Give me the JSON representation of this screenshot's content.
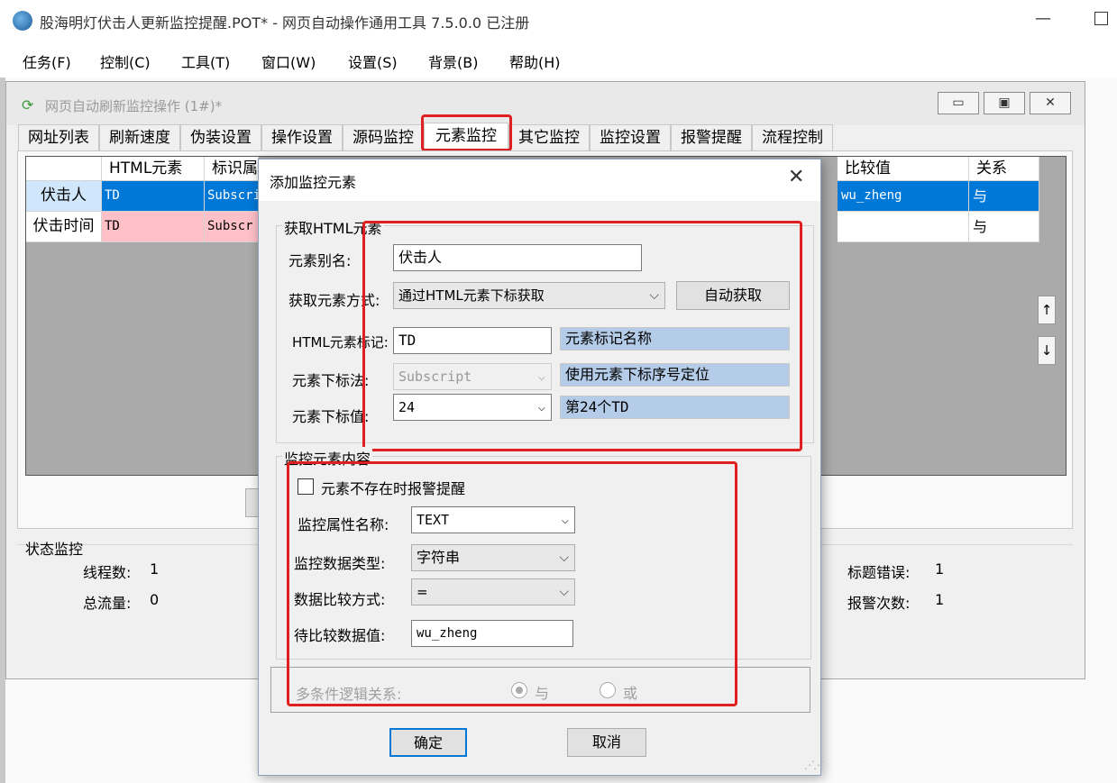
{
  "app": {
    "title": "股海明灯伏击人更新监控提醒.POT* - 网页自动操作通用工具 7.5.0.0  已注册",
    "min_glyph": "—",
    "menu": [
      "任务(F)",
      "控制(C)",
      "工具(T)",
      "窗口(W)",
      "设置(S)",
      "背景(B)",
      "帮助(H)"
    ]
  },
  "child": {
    "title": "网页自动刷新监控操作 (1#)*",
    "icon_glyph": "⟳",
    "buttons": [
      "▭",
      "▣",
      "✕"
    ],
    "tabs": [
      "网址列表",
      "刷新速度",
      "伪装设置",
      "操作设置",
      "源码监控",
      "元素监控",
      "其它监控",
      "监控设置",
      "报警提醒",
      "流程控制"
    ],
    "active_tab": "元素监控",
    "grid": {
      "headers": [
        "HTML元素",
        "标识属",
        "比较值",
        "关系"
      ],
      "rows": [
        {
          "name": "伏击人",
          "element": "TD",
          "attr": "Subscri",
          "compare": "wu_zheng",
          "relation": "与"
        },
        {
          "name": "伏击时间",
          "element": "TD",
          "attr": "Subscr",
          "compare": "",
          "relation": "与"
        }
      ]
    },
    "up_arrow": "↑",
    "down_arrow": "↓",
    "status": {
      "group_label": "状态监控",
      "threads_label": "线程数:",
      "threads_value": "1",
      "traffic_label": "总流量:",
      "traffic_value": "0",
      "title_error_label": "标题错误:",
      "title_error_value": "1",
      "alarm_count_label": "报警次数:",
      "alarm_count_value": "1"
    }
  },
  "dialog": {
    "title": "添加监控元素",
    "close_glyph": "✕",
    "get_group_label": "获取HTML元素",
    "alias_label": "元素别名:",
    "alias_value": "伏击人",
    "method_label": "获取元素方式:",
    "method_value": "通过HTML元素下标获取",
    "auto_get_button": "自动获取",
    "tag_label": "HTML元素标记:",
    "tag_value": "TD",
    "tag_hint": "元素标记名称",
    "index_method_label": "元素下标法:",
    "index_method_value": "Subscript",
    "index_method_hint": "使用元素下标序号定位",
    "index_value_label": "元素下标值:",
    "index_value": "24",
    "index_value_hint": "第24个TD",
    "monitor_group_label": "监控元素内容",
    "not_exist_alarm_label": "元素不存在时报警提醒",
    "attr_name_label": "监控属性名称:",
    "attr_name_value": "TEXT",
    "data_type_label": "监控数据类型:",
    "data_type_value": "字符串",
    "compare_method_label": "数据比较方式:",
    "compare_method_value": "=",
    "compare_value_label": "待比较数据值:",
    "compare_value": "wu_zheng",
    "logic_label": "多条件逻辑关系:",
    "logic_and": "与",
    "logic_or": "或",
    "ok_button": "确定",
    "cancel_button": "取消",
    "chevron": "⌵"
  }
}
